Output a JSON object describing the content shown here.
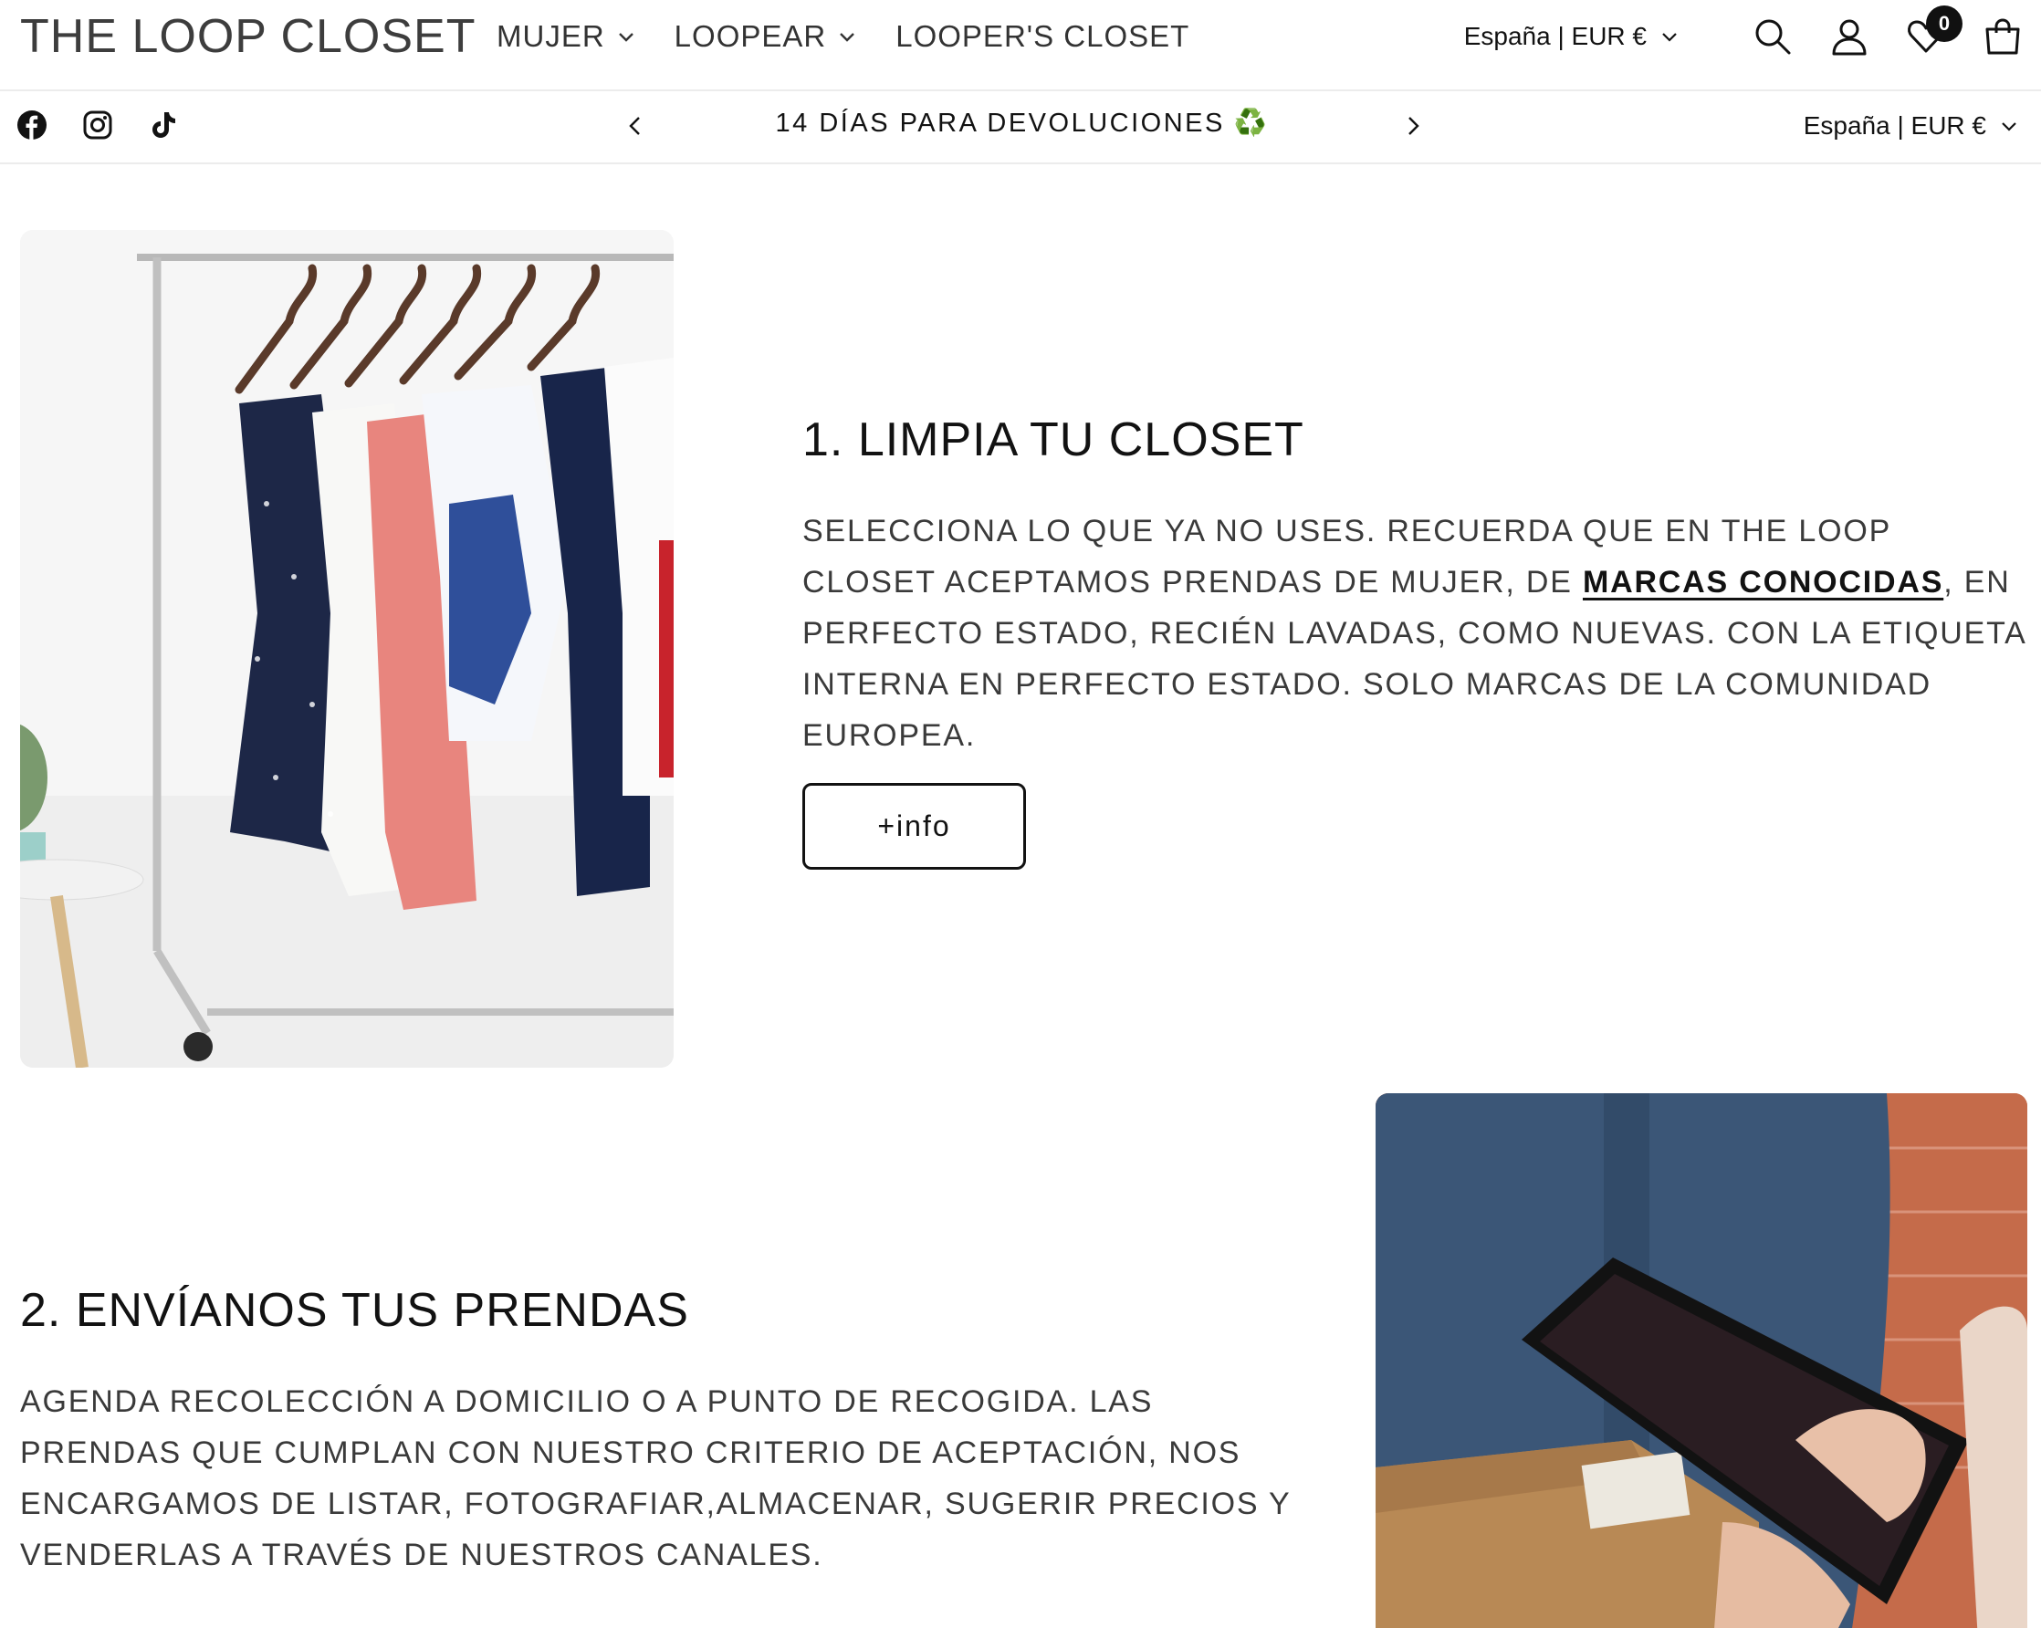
{
  "header": {
    "logo": "THE LOOP CLOSET",
    "nav": [
      {
        "label": "MUJER",
        "has_dropdown": true
      },
      {
        "label": "LOOPEAR",
        "has_dropdown": true
      },
      {
        "label": "LOOPER'S CLOSET",
        "has_dropdown": false
      }
    ],
    "locale": "España | EUR €",
    "icons": [
      "search-icon",
      "account-icon",
      "wishlist-icon",
      "cart-icon"
    ],
    "wishlist_count": "0"
  },
  "announcement": {
    "socials": [
      "facebook-icon",
      "instagram-icon",
      "tiktok-icon"
    ],
    "text": "14 DÍAS PARA DEVOLUCIONES",
    "emoji": "♻️",
    "locale": "España | EUR €"
  },
  "step1": {
    "title": "1. LIMPIA TU CLOSET",
    "body_part1": "SELECCIONA LO QUE YA NO USES. RECUERDA QUE EN THE LOOP CLOSET ACEPTAMOS PRENDAS DE MUJER, DE ",
    "body_link": "MARCAS CONOCIDAS",
    "body_part2": ", EN PERFECTO ESTADO, RECIÉN LAVADAS, COMO NUEVAS. CON LA ETIQUETA INTERNA EN PERFECTO ESTADO. SOLO MARCAS DE LA COMUNIDAD EUROPEA.",
    "button": "+info"
  },
  "step2": {
    "title": "2. ENVÍANOS TUS PRENDAS",
    "body": "AGENDA RECOLECCIÓN A DOMICILIO O A PUNTO DE RECOGIDA. LAS PRENDAS QUE CUMPLAN CON NUESTRO CRITERIO DE ACEPTACIÓN, NOS ENCARGAMOS DE LISTAR, FOTOGRAFIAR,ALMACENAR, SUGERIR PRECIOS Y VENDERLAS A TRAVÉS DE NUESTROS CANALES."
  },
  "colors": {
    "text": "#121212",
    "body_text": "#3a3a3a",
    "border": "#ececec",
    "accent_recycle": "#3aa541"
  }
}
